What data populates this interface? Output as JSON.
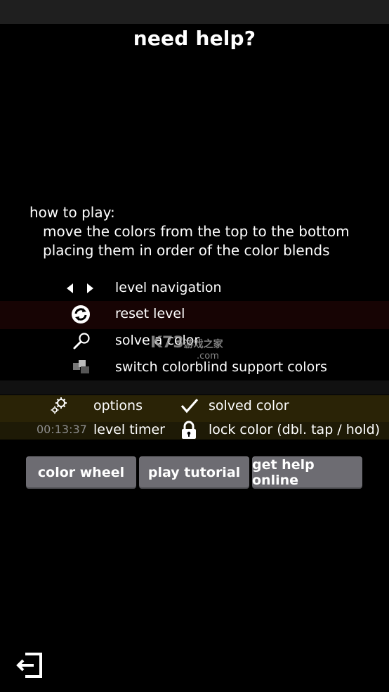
{
  "header": {
    "title": "need help?"
  },
  "howto": {
    "heading": "how to play:",
    "lines": [
      "move the colors from the top to the bottom",
      "placing them in order of the color blends"
    ]
  },
  "legend": {
    "items": [
      {
        "icon": "left-right-arrows-icon",
        "label": "level navigation"
      },
      {
        "icon": "reset-circular-arrows-icon",
        "label": "reset level"
      },
      {
        "icon": "magnifier-icon",
        "label": "solve a color"
      },
      {
        "icon": "colorblind-shapes-icon",
        "label": "switch colorblind support colors"
      }
    ]
  },
  "status_legend": {
    "options_label": "options",
    "solved_label": "solved color",
    "timer_value": "00:13:37",
    "timer_label": "level timer",
    "lock_label": "lock color (dbl. tap / hold)"
  },
  "buttons": {
    "color_wheel": "color wheel",
    "play_tutorial": "play tutorial",
    "get_help_online": "get help online"
  },
  "watermark": {
    "main": "K73",
    "cn": "游戏之家",
    "sub": ".com"
  },
  "colors": {
    "background": "#000000",
    "button": "#6d6c72",
    "band_red": "#1a0505",
    "band_gray": "#141414",
    "band_olive": "#2a2306",
    "timer_text": "#8d8d8d"
  }
}
